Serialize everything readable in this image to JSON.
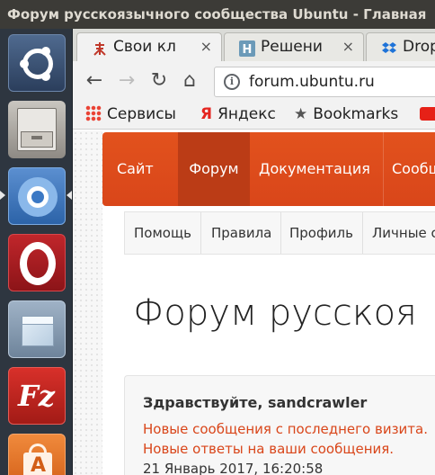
{
  "window": {
    "title": "Форум русскоязычного сообщества Ubuntu - Главная"
  },
  "launcher": {
    "items": [
      "ubuntu-dash",
      "files",
      "chromium",
      "opera",
      "package",
      "filezilla",
      "software-center"
    ]
  },
  "browser": {
    "tabs": [
      {
        "title": "Свои кл",
        "close": "×"
      },
      {
        "title": "Решени",
        "close": "×"
      },
      {
        "title": "Drop",
        "close": ""
      }
    ],
    "toolbar": {
      "back": "←",
      "forward": "→",
      "reload": "↻",
      "home": "⌂",
      "info": "i",
      "url": "forum.ubuntu.ru"
    },
    "bookmarks": [
      {
        "label": "Сервисы"
      },
      {
        "label": "Яндекс"
      },
      {
        "label": "Bookmarks"
      }
    ]
  },
  "page": {
    "nav": [
      "Сайт",
      "Форум",
      "Документация",
      "Сообщ"
    ],
    "subnav": [
      "Помощь",
      "Правила",
      "Профиль",
      "Личные с"
    ],
    "headline": "Форум русскоя",
    "welcome": {
      "greeting": "Здравствуйте, sandcrawler",
      "new_posts": "Новые сообщения с последнего визита.",
      "new_replies": "Новые ответы на ваши сообщения.",
      "date": "21 Январь 2017, 16:20:58"
    }
  },
  "colors": {
    "accent": "#dd4814",
    "launcher_bg": "#2e3640",
    "titlebar_bg": "#3c3b37"
  }
}
